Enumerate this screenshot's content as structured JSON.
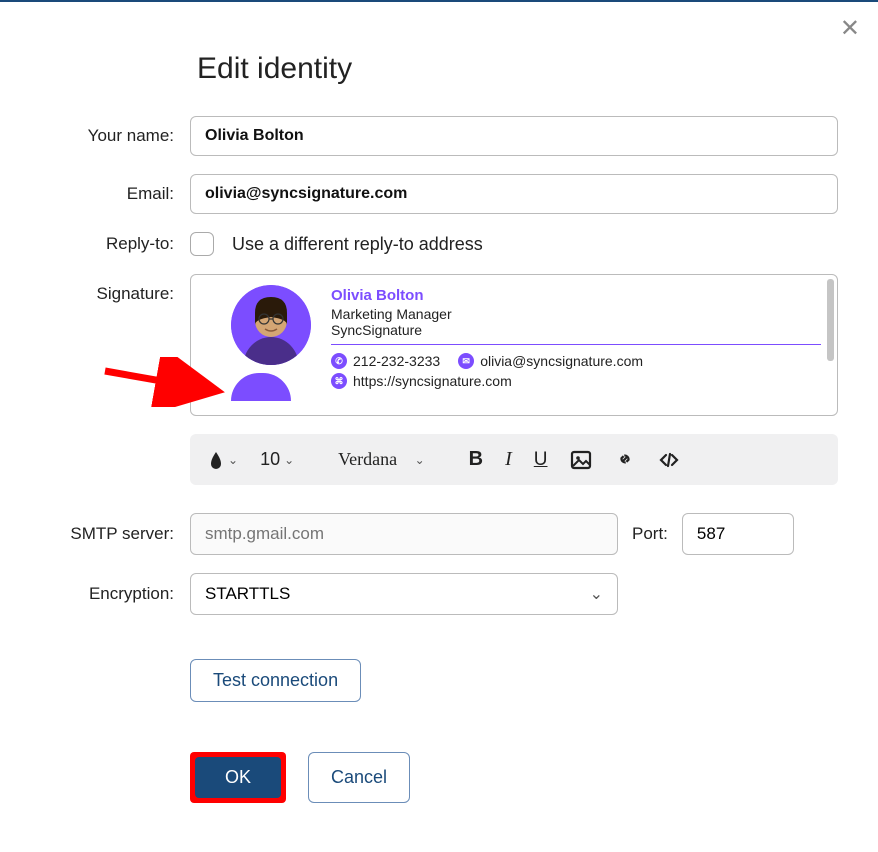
{
  "dialog": {
    "title": "Edit identity",
    "labels": {
      "yourName": "Your name:",
      "email": "Email:",
      "replyTo": "Reply-to:",
      "signature": "Signature:",
      "smtpServer": "SMTP server:",
      "port": "Port:",
      "encryption": "Encryption:"
    },
    "values": {
      "yourName": "Olivia Bolton",
      "email": "olivia@syncsignature.com",
      "replyToCheckbox": "Use a different reply-to address",
      "smtpPlaceholder": "smtp.gmail.com",
      "port": "587",
      "encryption": "STARTTLS"
    },
    "signature": {
      "name": "Olivia Bolton",
      "title": "Marketing Manager",
      "company": "SyncSignature",
      "phone": "212-232-3233",
      "emailAddr": "olivia@syncsignature.com",
      "website": "https://syncsignature.com"
    },
    "toolbar": {
      "fontSize": "10",
      "fontName": "Verdana"
    },
    "buttons": {
      "testConnection": "Test connection",
      "ok": "OK",
      "cancel": "Cancel"
    }
  }
}
